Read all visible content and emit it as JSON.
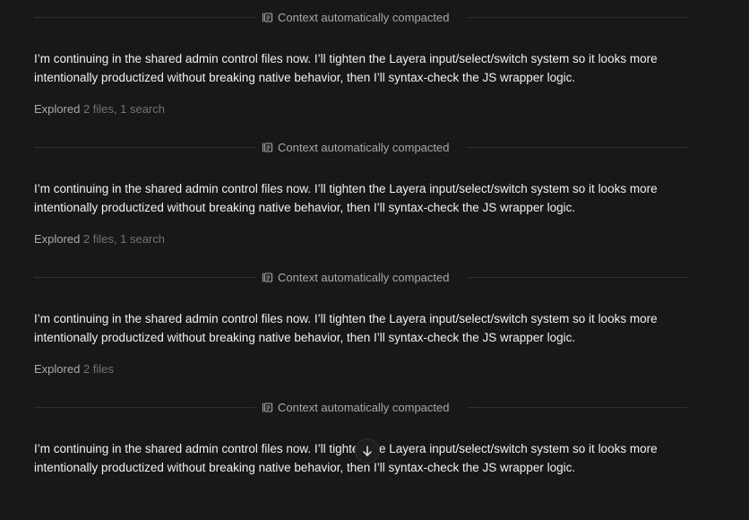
{
  "compaction_label": "Context automatically compacted",
  "blocks": [
    {
      "message_line1": "I’m continuing in the shared admin control files now. I’ll tighten the Layera input/select/switch system so it looks more",
      "message_line2": "intentionally productized without breaking native behavior, then I’ll syntax-check the JS wrapper logic.",
      "explored_verb": "Explored",
      "explored_detail": "2 files, 1 search"
    },
    {
      "message_line1": "I’m continuing in the shared admin control files now. I’ll tighten the Layera input/select/switch system so it looks more",
      "message_line2": "intentionally productized without breaking native behavior, then I’ll syntax-check the JS wrapper logic.",
      "explored_verb": "Explored",
      "explored_detail": "2 files, 1 search"
    },
    {
      "message_line1": "I’m continuing in the shared admin control files now. I’ll tighten the Layera input/select/switch system so it looks more",
      "message_line2": "intentionally productized without breaking native behavior, then I’ll syntax-check the JS wrapper logic.",
      "explored_verb": "Explored",
      "explored_detail": "2 files"
    },
    {
      "message_line1": "I’m continuing in the shared admin control files now. I’ll tighten the Layera input/select/switch system so it looks more",
      "message_line2": "intentionally productized without breaking native behavior, then I’ll syntax-check the JS wrapper logic."
    }
  ],
  "icons": {
    "compaction": "compact-context-icon",
    "scroll": "arrow-down-icon"
  },
  "colors": {
    "background": "#181818",
    "divider": "#2f2f2f",
    "message_text": "#f1f1f1",
    "muted_text": "#a8a8a8",
    "dim_text": "#727272"
  }
}
